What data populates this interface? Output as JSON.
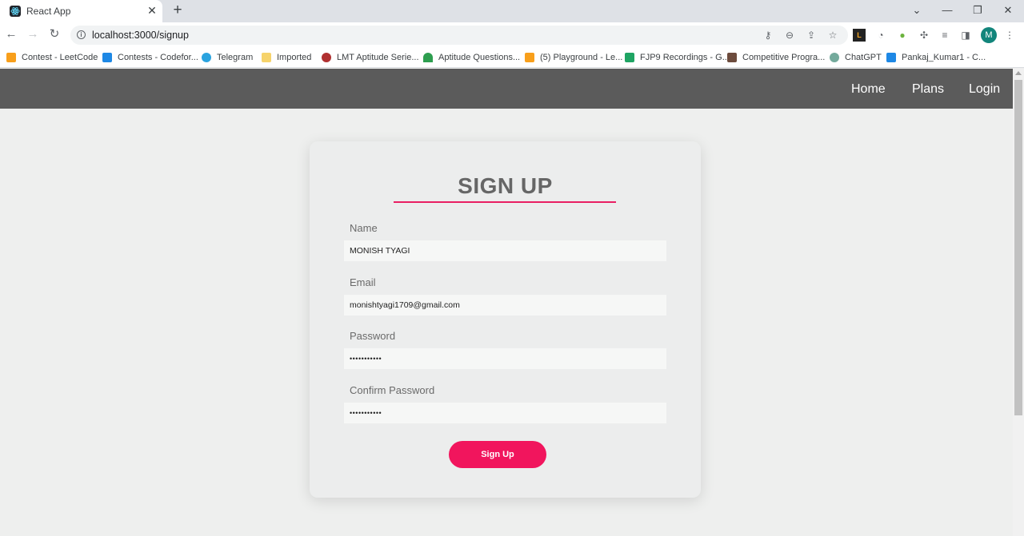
{
  "browser": {
    "tab_title": "React App",
    "url": "localhost:3000/signup",
    "profile_initial": "M",
    "bookmarks": [
      {
        "label": "Contest - LeetCode",
        "icon": "leetcode-icon",
        "color": "#f89f1b"
      },
      {
        "label": "Contests - Codefor...",
        "icon": "codeforces-icon",
        "color": "#1e88e5"
      },
      {
        "label": "Telegram",
        "icon": "telegram-icon",
        "color": "#2aa3df"
      },
      {
        "label": "Imported",
        "icon": "folder-icon",
        "color": "#f6d36b"
      },
      {
        "label": "LMT Aptitude Serie...",
        "icon": "lmt-icon",
        "color": "#b03030"
      },
      {
        "label": "Aptitude Questions...",
        "icon": "umbrella-icon",
        "color": "#2e9e4f"
      },
      {
        "label": "(5) Playground - Le...",
        "icon": "leetcode-icon",
        "color": "#f89f1b"
      },
      {
        "label": "FJP9 Recordings - G...",
        "icon": "sheets-icon",
        "color": "#1fa463"
      },
      {
        "label": "Competitive Progra...",
        "icon": "cc-icon",
        "color": "#6d4c3d"
      },
      {
        "label": "ChatGPT",
        "icon": "chatgpt-icon",
        "color": "#74aa9c"
      },
      {
        "label": "Pankaj_Kumar1 - C...",
        "icon": "codeforces-icon",
        "color": "#1e88e5"
      }
    ]
  },
  "nav": {
    "home": "Home",
    "plans": "Plans",
    "login": "Login"
  },
  "form": {
    "heading": "SIGN UP",
    "accent_color": "#e91e63",
    "name_label": "Name",
    "name_value": "MONISH TYAGI",
    "email_label": "Email",
    "email_value": "monishtyagi1709@gmail.com",
    "password_label": "Password",
    "password_value": "•••••••••••",
    "confirm_label": "Confirm Password",
    "confirm_value": "•••••••••••",
    "submit_label": "Sign Up",
    "submit_color": "#f1155d"
  }
}
